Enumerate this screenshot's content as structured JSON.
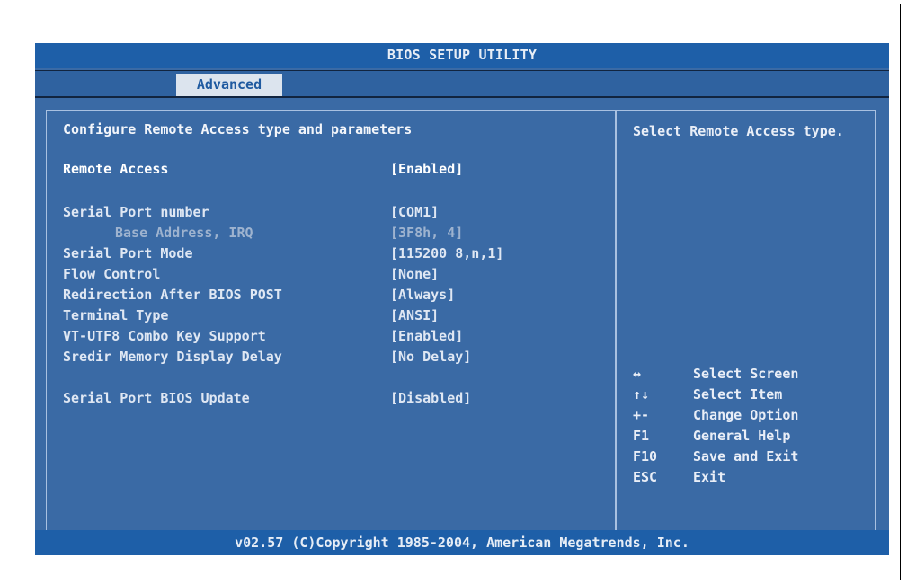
{
  "title": "BIOS SETUP UTILITY",
  "tabs": [
    {
      "label": "Advanced",
      "active": true
    }
  ],
  "main": {
    "heading": "Configure Remote Access type and parameters",
    "items": [
      {
        "label": "Remote Access",
        "value": "[Enabled]",
        "state": "highlight"
      },
      {
        "label": "Serial Port number",
        "value": "[COM1]",
        "state": "normal"
      },
      {
        "label": "Base Address, IRQ",
        "value": "[3F8h, 4]",
        "state": "dim"
      },
      {
        "label": "Serial Port Mode",
        "value": "[115200 8,n,1]",
        "state": "normal"
      },
      {
        "label": "Flow Control",
        "value": "[None]",
        "state": "normal"
      },
      {
        "label": "Redirection After BIOS POST",
        "value": "[Always]",
        "state": "normal"
      },
      {
        "label": "Terminal Type",
        "value": "[ANSI]",
        "state": "normal"
      },
      {
        "label": "VT-UTF8 Combo Key Support",
        "value": "[Enabled]",
        "state": "normal"
      },
      {
        "label": "Sredir Memory Display Delay",
        "value": "[No Delay]",
        "state": "normal"
      },
      {
        "label": "Serial Port BIOS Update",
        "value": "[Disabled]",
        "state": "normal"
      }
    ]
  },
  "help": {
    "text": "Select Remote Access type.",
    "keys": [
      {
        "key": "↔",
        "desc": "Select Screen",
        "icon": "left-right-arrow-icon"
      },
      {
        "key": "↑↓",
        "desc": "Select Item",
        "icon": "up-down-arrow-icon"
      },
      {
        "key": "+-",
        "desc": "Change Option"
      },
      {
        "key": "F1",
        "desc": "General Help"
      },
      {
        "key": "F10",
        "desc": "Save and Exit"
      },
      {
        "key": "ESC",
        "desc": "Exit"
      }
    ]
  },
  "footer": "v02.57 (C)Copyright 1985-2004, American Megatrends, Inc.",
  "colors": {
    "background": "#3a6aa5",
    "title_bar": "#1e5fa8",
    "tab_active_bg": "#dce4ee",
    "border": "#a9c1e1"
  }
}
